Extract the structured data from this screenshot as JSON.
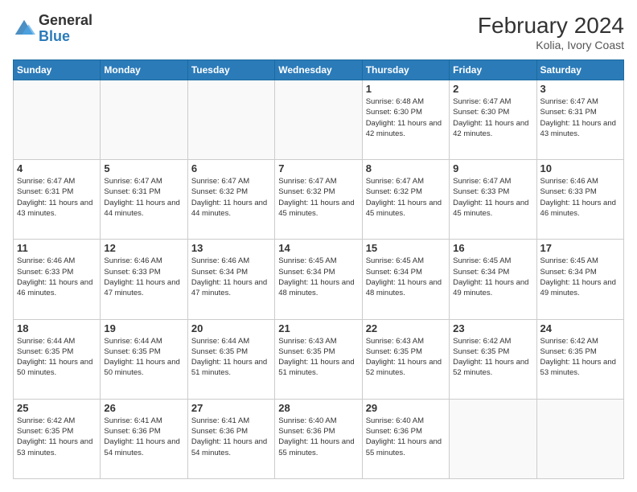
{
  "header": {
    "logo": {
      "general": "General",
      "blue": "Blue"
    },
    "title": "February 2024",
    "location": "Kolia, Ivory Coast"
  },
  "days_of_week": [
    "Sunday",
    "Monday",
    "Tuesday",
    "Wednesday",
    "Thursday",
    "Friday",
    "Saturday"
  ],
  "weeks": [
    [
      {
        "day": "",
        "info": ""
      },
      {
        "day": "",
        "info": ""
      },
      {
        "day": "",
        "info": ""
      },
      {
        "day": "",
        "info": ""
      },
      {
        "day": "1",
        "info": "Sunrise: 6:48 AM\nSunset: 6:30 PM\nDaylight: 11 hours\nand 42 minutes."
      },
      {
        "day": "2",
        "info": "Sunrise: 6:47 AM\nSunset: 6:30 PM\nDaylight: 11 hours\nand 42 minutes."
      },
      {
        "day": "3",
        "info": "Sunrise: 6:47 AM\nSunset: 6:31 PM\nDaylight: 11 hours\nand 43 minutes."
      }
    ],
    [
      {
        "day": "4",
        "info": "Sunrise: 6:47 AM\nSunset: 6:31 PM\nDaylight: 11 hours\nand 43 minutes."
      },
      {
        "day": "5",
        "info": "Sunrise: 6:47 AM\nSunset: 6:31 PM\nDaylight: 11 hours\nand 44 minutes."
      },
      {
        "day": "6",
        "info": "Sunrise: 6:47 AM\nSunset: 6:32 PM\nDaylight: 11 hours\nand 44 minutes."
      },
      {
        "day": "7",
        "info": "Sunrise: 6:47 AM\nSunset: 6:32 PM\nDaylight: 11 hours\nand 45 minutes."
      },
      {
        "day": "8",
        "info": "Sunrise: 6:47 AM\nSunset: 6:32 PM\nDaylight: 11 hours\nand 45 minutes."
      },
      {
        "day": "9",
        "info": "Sunrise: 6:47 AM\nSunset: 6:33 PM\nDaylight: 11 hours\nand 45 minutes."
      },
      {
        "day": "10",
        "info": "Sunrise: 6:46 AM\nSunset: 6:33 PM\nDaylight: 11 hours\nand 46 minutes."
      }
    ],
    [
      {
        "day": "11",
        "info": "Sunrise: 6:46 AM\nSunset: 6:33 PM\nDaylight: 11 hours\nand 46 minutes."
      },
      {
        "day": "12",
        "info": "Sunrise: 6:46 AM\nSunset: 6:33 PM\nDaylight: 11 hours\nand 47 minutes."
      },
      {
        "day": "13",
        "info": "Sunrise: 6:46 AM\nSunset: 6:34 PM\nDaylight: 11 hours\nand 47 minutes."
      },
      {
        "day": "14",
        "info": "Sunrise: 6:45 AM\nSunset: 6:34 PM\nDaylight: 11 hours\nand 48 minutes."
      },
      {
        "day": "15",
        "info": "Sunrise: 6:45 AM\nSunset: 6:34 PM\nDaylight: 11 hours\nand 48 minutes."
      },
      {
        "day": "16",
        "info": "Sunrise: 6:45 AM\nSunset: 6:34 PM\nDaylight: 11 hours\nand 49 minutes."
      },
      {
        "day": "17",
        "info": "Sunrise: 6:45 AM\nSunset: 6:34 PM\nDaylight: 11 hours\nand 49 minutes."
      }
    ],
    [
      {
        "day": "18",
        "info": "Sunrise: 6:44 AM\nSunset: 6:35 PM\nDaylight: 11 hours\nand 50 minutes."
      },
      {
        "day": "19",
        "info": "Sunrise: 6:44 AM\nSunset: 6:35 PM\nDaylight: 11 hours\nand 50 minutes."
      },
      {
        "day": "20",
        "info": "Sunrise: 6:44 AM\nSunset: 6:35 PM\nDaylight: 11 hours\nand 51 minutes."
      },
      {
        "day": "21",
        "info": "Sunrise: 6:43 AM\nSunset: 6:35 PM\nDaylight: 11 hours\nand 51 minutes."
      },
      {
        "day": "22",
        "info": "Sunrise: 6:43 AM\nSunset: 6:35 PM\nDaylight: 11 hours\nand 52 minutes."
      },
      {
        "day": "23",
        "info": "Sunrise: 6:42 AM\nSunset: 6:35 PM\nDaylight: 11 hours\nand 52 minutes."
      },
      {
        "day": "24",
        "info": "Sunrise: 6:42 AM\nSunset: 6:35 PM\nDaylight: 11 hours\nand 53 minutes."
      }
    ],
    [
      {
        "day": "25",
        "info": "Sunrise: 6:42 AM\nSunset: 6:35 PM\nDaylight: 11 hours\nand 53 minutes."
      },
      {
        "day": "26",
        "info": "Sunrise: 6:41 AM\nSunset: 6:36 PM\nDaylight: 11 hours\nand 54 minutes."
      },
      {
        "day": "27",
        "info": "Sunrise: 6:41 AM\nSunset: 6:36 PM\nDaylight: 11 hours\nand 54 minutes."
      },
      {
        "day": "28",
        "info": "Sunrise: 6:40 AM\nSunset: 6:36 PM\nDaylight: 11 hours\nand 55 minutes."
      },
      {
        "day": "29",
        "info": "Sunrise: 6:40 AM\nSunset: 6:36 PM\nDaylight: 11 hours\nand 55 minutes."
      },
      {
        "day": "",
        "info": ""
      },
      {
        "day": "",
        "info": ""
      }
    ]
  ]
}
